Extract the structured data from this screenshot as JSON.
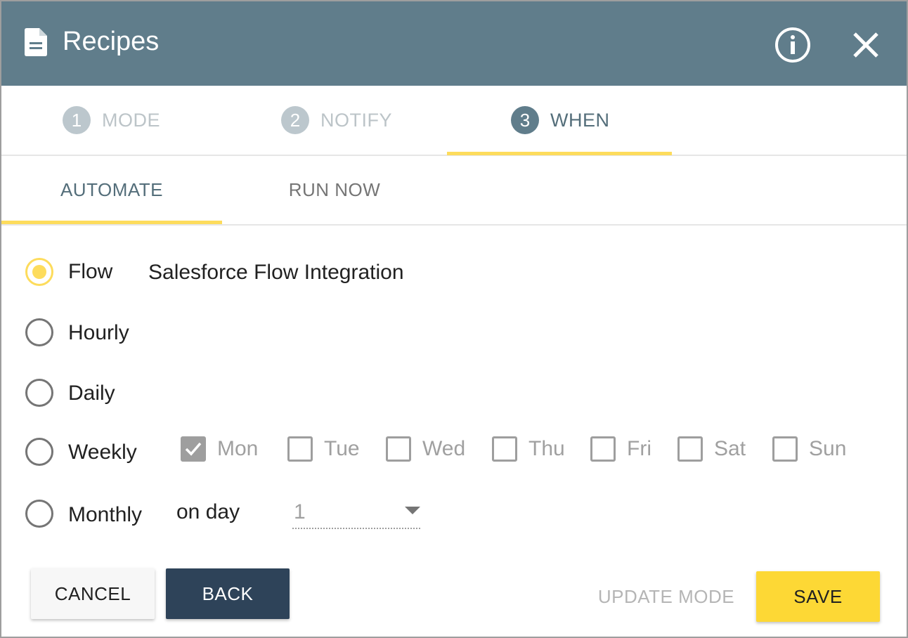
{
  "header": {
    "title": "Recipes",
    "icon": "document-icon",
    "info_icon": "info-icon",
    "close_icon": "close-icon",
    "background": "#607d8b"
  },
  "steps": [
    {
      "number": "1",
      "label": "MODE",
      "active": false
    },
    {
      "number": "2",
      "label": "NOTIFY",
      "active": false
    },
    {
      "number": "3",
      "label": "WHEN",
      "active": true
    }
  ],
  "tabs": [
    {
      "label": "AUTOMATE",
      "active": true
    },
    {
      "label": "RUN NOW",
      "active": false
    }
  ],
  "schedule": {
    "flow": {
      "label": "Flow",
      "value": "Salesforce Flow Integration",
      "selected": true
    },
    "hourly": {
      "label": "Hourly",
      "selected": false
    },
    "daily": {
      "label": "Daily",
      "selected": false
    },
    "weekly": {
      "label": "Weekly",
      "selected": false,
      "days": [
        {
          "label": "Mon",
          "checked": true
        },
        {
          "label": "Tue",
          "checked": false
        },
        {
          "label": "Wed",
          "checked": false
        },
        {
          "label": "Thu",
          "checked": false
        },
        {
          "label": "Fri",
          "checked": false
        },
        {
          "label": "Sat",
          "checked": false
        },
        {
          "label": "Sun",
          "checked": false
        }
      ]
    },
    "monthly": {
      "label": "Monthly",
      "selected": false,
      "on_day_label": "on day",
      "day_value": "1"
    }
  },
  "footer": {
    "cancel_label": "CANCEL",
    "back_label": "BACK",
    "update_mode_label": "UPDATE MODE",
    "save_label": "SAVE"
  },
  "colors": {
    "accent": "#fddc5c",
    "save_button": "#fdd835",
    "back_button": "#2e4359",
    "step_active": "#607d8b"
  }
}
